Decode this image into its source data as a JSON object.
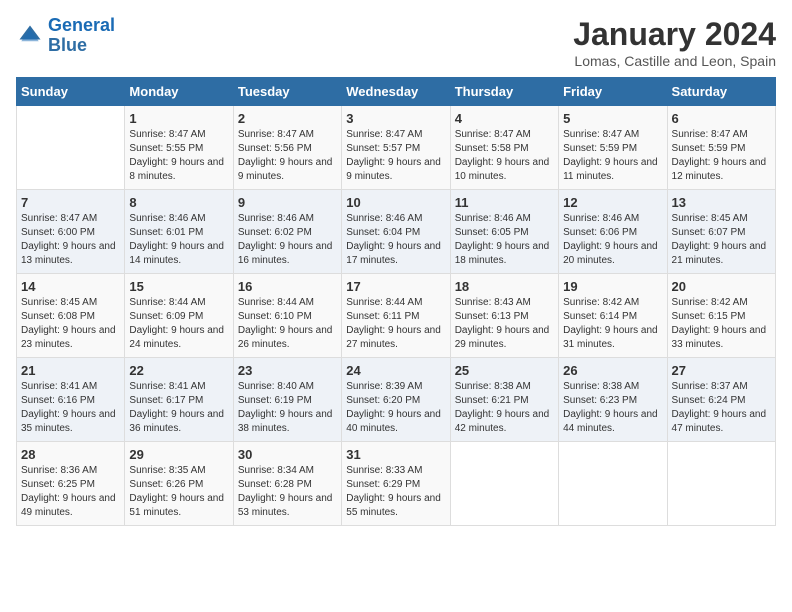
{
  "header": {
    "logo_line1": "General",
    "logo_line2": "Blue",
    "month": "January 2024",
    "location": "Lomas, Castille and Leon, Spain"
  },
  "days_of_week": [
    "Sunday",
    "Monday",
    "Tuesday",
    "Wednesday",
    "Thursday",
    "Friday",
    "Saturday"
  ],
  "weeks": [
    [
      {
        "day": "",
        "sunrise": "",
        "sunset": "",
        "daylight": ""
      },
      {
        "day": "1",
        "sunrise": "Sunrise: 8:47 AM",
        "sunset": "Sunset: 5:55 PM",
        "daylight": "Daylight: 9 hours and 8 minutes."
      },
      {
        "day": "2",
        "sunrise": "Sunrise: 8:47 AM",
        "sunset": "Sunset: 5:56 PM",
        "daylight": "Daylight: 9 hours and 9 minutes."
      },
      {
        "day": "3",
        "sunrise": "Sunrise: 8:47 AM",
        "sunset": "Sunset: 5:57 PM",
        "daylight": "Daylight: 9 hours and 9 minutes."
      },
      {
        "day": "4",
        "sunrise": "Sunrise: 8:47 AM",
        "sunset": "Sunset: 5:58 PM",
        "daylight": "Daylight: 9 hours and 10 minutes."
      },
      {
        "day": "5",
        "sunrise": "Sunrise: 8:47 AM",
        "sunset": "Sunset: 5:59 PM",
        "daylight": "Daylight: 9 hours and 11 minutes."
      },
      {
        "day": "6",
        "sunrise": "Sunrise: 8:47 AM",
        "sunset": "Sunset: 5:59 PM",
        "daylight": "Daylight: 9 hours and 12 minutes."
      }
    ],
    [
      {
        "day": "7",
        "sunrise": "Sunrise: 8:47 AM",
        "sunset": "Sunset: 6:00 PM",
        "daylight": "Daylight: 9 hours and 13 minutes."
      },
      {
        "day": "8",
        "sunrise": "Sunrise: 8:46 AM",
        "sunset": "Sunset: 6:01 PM",
        "daylight": "Daylight: 9 hours and 14 minutes."
      },
      {
        "day": "9",
        "sunrise": "Sunrise: 8:46 AM",
        "sunset": "Sunset: 6:02 PM",
        "daylight": "Daylight: 9 hours and 16 minutes."
      },
      {
        "day": "10",
        "sunrise": "Sunrise: 8:46 AM",
        "sunset": "Sunset: 6:04 PM",
        "daylight": "Daylight: 9 hours and 17 minutes."
      },
      {
        "day": "11",
        "sunrise": "Sunrise: 8:46 AM",
        "sunset": "Sunset: 6:05 PM",
        "daylight": "Daylight: 9 hours and 18 minutes."
      },
      {
        "day": "12",
        "sunrise": "Sunrise: 8:46 AM",
        "sunset": "Sunset: 6:06 PM",
        "daylight": "Daylight: 9 hours and 20 minutes."
      },
      {
        "day": "13",
        "sunrise": "Sunrise: 8:45 AM",
        "sunset": "Sunset: 6:07 PM",
        "daylight": "Daylight: 9 hours and 21 minutes."
      }
    ],
    [
      {
        "day": "14",
        "sunrise": "Sunrise: 8:45 AM",
        "sunset": "Sunset: 6:08 PM",
        "daylight": "Daylight: 9 hours and 23 minutes."
      },
      {
        "day": "15",
        "sunrise": "Sunrise: 8:44 AM",
        "sunset": "Sunset: 6:09 PM",
        "daylight": "Daylight: 9 hours and 24 minutes."
      },
      {
        "day": "16",
        "sunrise": "Sunrise: 8:44 AM",
        "sunset": "Sunset: 6:10 PM",
        "daylight": "Daylight: 9 hours and 26 minutes."
      },
      {
        "day": "17",
        "sunrise": "Sunrise: 8:44 AM",
        "sunset": "Sunset: 6:11 PM",
        "daylight": "Daylight: 9 hours and 27 minutes."
      },
      {
        "day": "18",
        "sunrise": "Sunrise: 8:43 AM",
        "sunset": "Sunset: 6:13 PM",
        "daylight": "Daylight: 9 hours and 29 minutes."
      },
      {
        "day": "19",
        "sunrise": "Sunrise: 8:42 AM",
        "sunset": "Sunset: 6:14 PM",
        "daylight": "Daylight: 9 hours and 31 minutes."
      },
      {
        "day": "20",
        "sunrise": "Sunrise: 8:42 AM",
        "sunset": "Sunset: 6:15 PM",
        "daylight": "Daylight: 9 hours and 33 minutes."
      }
    ],
    [
      {
        "day": "21",
        "sunrise": "Sunrise: 8:41 AM",
        "sunset": "Sunset: 6:16 PM",
        "daylight": "Daylight: 9 hours and 35 minutes."
      },
      {
        "day": "22",
        "sunrise": "Sunrise: 8:41 AM",
        "sunset": "Sunset: 6:17 PM",
        "daylight": "Daylight: 9 hours and 36 minutes."
      },
      {
        "day": "23",
        "sunrise": "Sunrise: 8:40 AM",
        "sunset": "Sunset: 6:19 PM",
        "daylight": "Daylight: 9 hours and 38 minutes."
      },
      {
        "day": "24",
        "sunrise": "Sunrise: 8:39 AM",
        "sunset": "Sunset: 6:20 PM",
        "daylight": "Daylight: 9 hours and 40 minutes."
      },
      {
        "day": "25",
        "sunrise": "Sunrise: 8:38 AM",
        "sunset": "Sunset: 6:21 PM",
        "daylight": "Daylight: 9 hours and 42 minutes."
      },
      {
        "day": "26",
        "sunrise": "Sunrise: 8:38 AM",
        "sunset": "Sunset: 6:23 PM",
        "daylight": "Daylight: 9 hours and 44 minutes."
      },
      {
        "day": "27",
        "sunrise": "Sunrise: 8:37 AM",
        "sunset": "Sunset: 6:24 PM",
        "daylight": "Daylight: 9 hours and 47 minutes."
      }
    ],
    [
      {
        "day": "28",
        "sunrise": "Sunrise: 8:36 AM",
        "sunset": "Sunset: 6:25 PM",
        "daylight": "Daylight: 9 hours and 49 minutes."
      },
      {
        "day": "29",
        "sunrise": "Sunrise: 8:35 AM",
        "sunset": "Sunset: 6:26 PM",
        "daylight": "Daylight: 9 hours and 51 minutes."
      },
      {
        "day": "30",
        "sunrise": "Sunrise: 8:34 AM",
        "sunset": "Sunset: 6:28 PM",
        "daylight": "Daylight: 9 hours and 53 minutes."
      },
      {
        "day": "31",
        "sunrise": "Sunrise: 8:33 AM",
        "sunset": "Sunset: 6:29 PM",
        "daylight": "Daylight: 9 hours and 55 minutes."
      },
      {
        "day": "",
        "sunrise": "",
        "sunset": "",
        "daylight": ""
      },
      {
        "day": "",
        "sunrise": "",
        "sunset": "",
        "daylight": ""
      },
      {
        "day": "",
        "sunrise": "",
        "sunset": "",
        "daylight": ""
      }
    ]
  ]
}
